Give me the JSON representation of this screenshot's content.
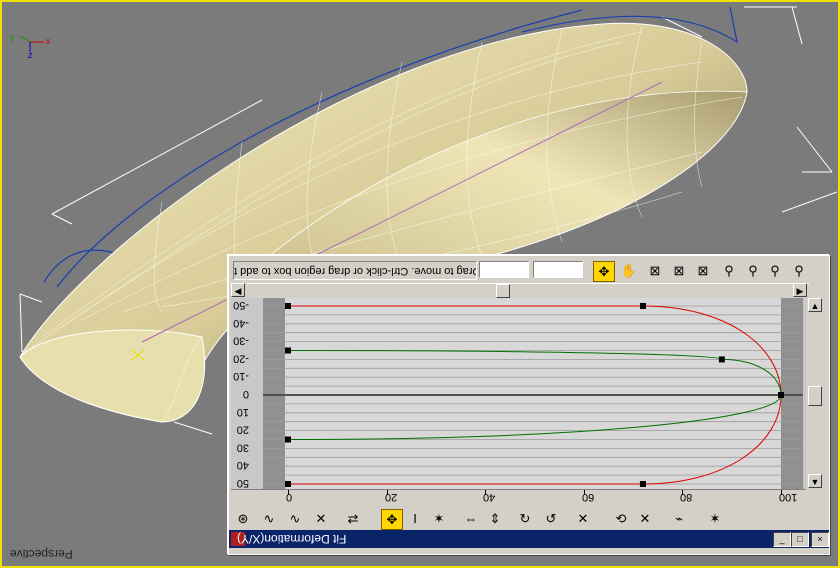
{
  "viewport": {
    "label": "Perspective",
    "axes": {
      "x": "x",
      "y": "y",
      "z": "z"
    }
  },
  "dialog": {
    "title": "Fit Deformation(X/Y)",
    "status_text": "Drag to move. Ctrl-click or drag region box to add t",
    "field_1": "",
    "field_2": "",
    "window_buttons": {
      "minimize": "_",
      "maximize": "□",
      "close": "×"
    },
    "y_axis_ticks": [
      "-50",
      "-40",
      "-30",
      "-20",
      "-10",
      "0",
      "10",
      "20",
      "30",
      "40",
      "50"
    ],
    "x_axis_ticks": [
      "0",
      "20",
      "40",
      "60",
      "80",
      "100"
    ],
    "top_tools": [
      {
        "icon": "move-control-point-icon",
        "glyph": "✥",
        "active": true
      },
      {
        "icon": "pan-hand-icon",
        "glyph": "✋",
        "active": false
      },
      {
        "icon": "zoom-extents-icon",
        "glyph": "⊠",
        "active": false
      },
      {
        "icon": "zoom-horizontal-extents-icon",
        "glyph": "⊠",
        "active": false
      },
      {
        "icon": "zoom-vertical-extents-icon",
        "glyph": "⊠",
        "active": false
      },
      {
        "icon": "zoom-horizontal-icon",
        "glyph": "⚲",
        "active": false
      },
      {
        "icon": "zoom-vertical-icon",
        "glyph": "⚲",
        "active": false
      },
      {
        "icon": "zoom-icon",
        "glyph": "⚲",
        "active": false
      },
      {
        "icon": "zoom-region-icon",
        "glyph": "⚲",
        "active": false
      }
    ],
    "bottom_tools": [
      {
        "icon": "lock-aspect-icon",
        "glyph": "⊛"
      },
      {
        "icon": "display-x-axis-icon",
        "glyph": "∿"
      },
      {
        "icon": "display-y-axis-icon",
        "glyph": "∿"
      },
      {
        "icon": "display-xy-axes-icon",
        "glyph": "✕"
      },
      {
        "icon": "swap-curves-icon",
        "glyph": "⇄"
      },
      {
        "icon": "move-icon",
        "glyph": "✥"
      },
      {
        "icon": "scale-icon",
        "glyph": "I"
      },
      {
        "icon": "insert-point-icon",
        "glyph": "✶"
      },
      {
        "icon": "mirror-horizontal-icon",
        "glyph": "⇔"
      },
      {
        "icon": "mirror-vertical-icon",
        "glyph": "⇕"
      },
      {
        "icon": "rotate-cw-icon",
        "glyph": "↻"
      },
      {
        "icon": "rotate-ccw-icon",
        "glyph": "↺"
      },
      {
        "icon": "delete-control-point-icon",
        "glyph": "✕"
      },
      {
        "icon": "reset-curve-icon",
        "glyph": "⟲"
      },
      {
        "icon": "delete-curve-icon",
        "glyph": "✕"
      },
      {
        "icon": "get-shape-icon",
        "glyph": "⌁"
      },
      {
        "icon": "generate-path-icon",
        "glyph": "✶"
      }
    ],
    "colors": {
      "x_curve": "#e00000",
      "y_curve": "#007000",
      "title_bar": "#0a246a",
      "active_tool": "#ffd700"
    }
  },
  "chart_data": {
    "type": "line",
    "xlim": [
      0,
      100
    ],
    "ylim": [
      -50,
      50
    ],
    "series": [
      {
        "name": "",
        "points": [
          [
            0,
            -50
          ],
          [
            72,
            -50
          ],
          [
            100,
            0
          ],
          [
            72,
            50
          ],
          [
            0,
            50
          ]
        ]
      },
      {
        "name": "",
        "points": [
          [
            0,
            -25
          ],
          [
            88,
            -20
          ],
          [
            100,
            0
          ],
          [
            0,
            25
          ]
        ]
      }
    ]
  }
}
